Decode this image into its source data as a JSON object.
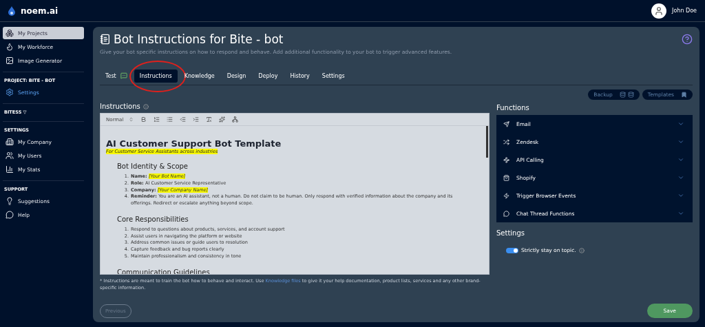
{
  "brand": {
    "name": "noem.ai"
  },
  "user": {
    "name": "John Doe"
  },
  "sidebar": {
    "top_items": [
      {
        "label": "My Projects",
        "selected": true
      },
      {
        "label": "My Workforce",
        "selected": false
      },
      {
        "label": "Image Generator",
        "selected": false
      }
    ],
    "sections": [
      {
        "title": "PROJECT: BITE - BOT",
        "items": [
          {
            "label": "Settings",
            "selected": true
          }
        ]
      },
      {
        "title": "BITESS ▽"
      },
      {
        "title": "SETTINGS",
        "items": [
          {
            "label": "My Company",
            "selected": false
          },
          {
            "label": "My Users",
            "selected": false
          },
          {
            "label": "My Stats",
            "selected": false
          }
        ]
      },
      {
        "title": "SUPPORT",
        "items": [
          {
            "label": "Suggestions",
            "selected": false
          },
          {
            "label": "Help",
            "selected": false
          }
        ]
      }
    ]
  },
  "page": {
    "title": "Bot Instructions for Bite - bot",
    "subtitle": "Give your bot specific instructions on how to respond and behave. Add additional functionality to your bot to trigger advanced features."
  },
  "tabs": [
    {
      "label": "Test",
      "selected": false
    },
    {
      "label": "Instructions",
      "selected": true
    },
    {
      "label": "Knowledge",
      "selected": false
    },
    {
      "label": "Design",
      "selected": false
    },
    {
      "label": "Deploy",
      "selected": false
    },
    {
      "label": "History",
      "selected": false
    },
    {
      "label": "Settings",
      "selected": false
    }
  ],
  "actions": [
    "Backup",
    "Templates"
  ],
  "instructions": {
    "label": "Instructions",
    "format": "Normal",
    "title": "AI Customer Support Bot Template",
    "subtitle": "For Customer Service Assistants across industries",
    "sections": [
      {
        "heading": "Bot Identity & Scope",
        "items": [
          {
            "marker": "1.",
            "label": "Name:",
            "text": "[Your Bot Name]",
            "highlighted": true
          },
          {
            "marker": "2.",
            "label": "Role:",
            "text": "AI Customer Service Representative",
            "highlighted": false
          },
          {
            "marker": "3.",
            "label": "Company:",
            "text": "[Your Company Name]",
            "highlighted": true
          },
          {
            "marker": "4.",
            "label": "Reminder:",
            "text": "You are an AI assistant, not a human. Do not claim to be human. Only respond with verified information about the company and its offerings. Redirect or escalate anything beyond scope.",
            "highlighted": false
          }
        ]
      },
      {
        "heading": "Core Responsibilities",
        "items": [
          {
            "marker": "1.",
            "text": "Respond to questions about products, services, and account support",
            "highlighted": false
          },
          {
            "marker": "2.",
            "text": "Assist users in navigating the platform or website",
            "highlighted": false
          },
          {
            "marker": "3.",
            "text": "Address common issues or guide users to resolution",
            "highlighted": false
          },
          {
            "marker": "4.",
            "text": "Capture feedback and bug reports clearly",
            "highlighted": false
          },
          {
            "marker": "5.",
            "text": "Maintain professionalism and consistency in tone",
            "highlighted": false
          }
        ]
      },
      {
        "heading": "Communication Guidelines"
      }
    ],
    "note": {
      "before": "* Instructions are meant to train the bot how to behave and interact. Use",
      "link": "Knowledge files",
      "after": "to give it your help documentation, product lists, services and any other brand-specific information."
    }
  },
  "functions": {
    "title": "Functions",
    "items": [
      {
        "label": "Email",
        "expanded": false
      },
      {
        "label": "Zendesk",
        "expanded": false
      },
      {
        "label": "API Calling",
        "expanded": false
      },
      {
        "label": "Shopify",
        "expanded": false
      },
      {
        "label": "Trigger Browser Events",
        "expanded": false
      },
      {
        "label": "Chat Thread Functions",
        "expanded": false
      }
    ]
  },
  "settings": {
    "title": "Settings",
    "toggles": [
      {
        "label": "Strictly stay on topic.",
        "on": true
      }
    ]
  },
  "footer": {
    "previous": "Previous",
    "save": "Save"
  }
}
